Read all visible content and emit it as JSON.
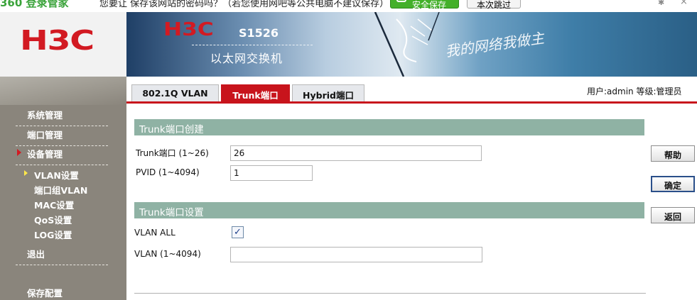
{
  "notify": {
    "brand": "360 登录管家",
    "message": "您要让 保存该网站的密码吗？（若您使用网吧等公共电脑不建议保存）",
    "save_button": "安全保存",
    "skip_button": "本次跳过",
    "pin_glyph": "✱",
    "close_glyph": "×"
  },
  "logo": "H3C",
  "banner": {
    "brand": "H3C",
    "model": "S1526",
    "subtitle": "以太网交换机",
    "slogan": "我的网络我做主"
  },
  "sidebar": {
    "items": [
      {
        "label": "系统管理"
      },
      {
        "label": "端口管理"
      },
      {
        "label": "设备管理"
      }
    ],
    "subitems": [
      {
        "label": "VLAN设置"
      },
      {
        "label": "端口组VLAN"
      },
      {
        "label": "MAC设置"
      },
      {
        "label": "QoS设置"
      },
      {
        "label": "LOG设置"
      }
    ],
    "logout": "退出",
    "save_config": "保存配置"
  },
  "tabs": [
    {
      "label": "802.1Q VLAN"
    },
    {
      "label": "Trunk端口"
    },
    {
      "label": "Hybrid端口"
    }
  ],
  "active_tab": "Trunk端口",
  "user_info": "用户:admin  等级:管理员",
  "create_section": {
    "title": "Trunk端口创建",
    "trunk_port_label": "Trunk端口 (1~26)",
    "trunk_port_value": "26",
    "pvid_label": "PVID (1~4094)",
    "pvid_value": "1"
  },
  "settings_section": {
    "title": "Trunk端口设置",
    "vlan_all_label": "VLAN ALL",
    "vlan_all_checked": true,
    "vlan_label": "VLAN (1~4094)",
    "vlan_value": ""
  },
  "buttons": {
    "help": "帮助",
    "confirm": "确定",
    "back": "返回"
  },
  "colors": {
    "accent_red": "#c8141c",
    "section_green": "#8fb2a4",
    "sidebar_gray": "#8a857c"
  }
}
